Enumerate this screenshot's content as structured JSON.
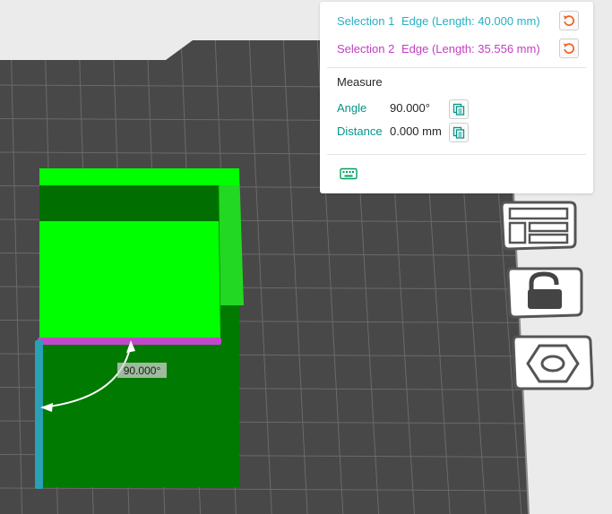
{
  "selections": [
    {
      "name": "Selection 1",
      "description": "Edge (Length: 40.000 mm)",
      "color": "#26b0c4"
    },
    {
      "name": "Selection 2",
      "description": "Edge (Length: 35.556 mm)",
      "color": "#c040c0"
    }
  ],
  "measure": {
    "title": "Measure",
    "angle_label": "Angle",
    "angle_value": "90.000°",
    "distance_label": "Distance",
    "distance_value": "0.000 mm"
  },
  "viewport": {
    "angle_annotation": "90.000°"
  },
  "icons": {
    "reset": "rotate-ccw-icon",
    "copy": "copy-icon",
    "keyboard": "keyboard-icon",
    "layout": "layout-panel-icon",
    "lock": "lock-icon",
    "hex": "hex-nut-icon"
  },
  "colors": {
    "accent_teal": "#009688",
    "reset_orange": "#f26522",
    "model_bright": "#00ff00",
    "model_dark": "#007a00",
    "plate": "#484848",
    "grid": "#6a6a6a"
  }
}
